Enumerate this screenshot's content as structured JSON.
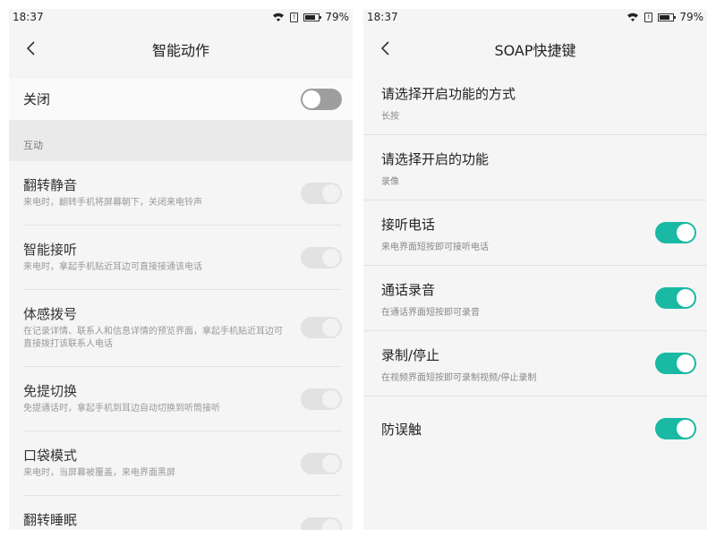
{
  "left": {
    "status": {
      "time": "18:37",
      "battery": "79%",
      "sim": "!"
    },
    "title": "智能动作",
    "master": {
      "label": "关闭",
      "on": false
    },
    "section": "互动",
    "items": [
      {
        "title": "翻转静音",
        "desc": "来电时，翻转手机将屏幕朝下，关闭来电铃声"
      },
      {
        "title": "智能接听",
        "desc": "来电时，拿起手机贴近耳边可直接接通该电话"
      },
      {
        "title": "体感拨号",
        "desc": "在记录详情、联系人和信息详情的预览界面，拿起手机贴近耳边可直接拨打该联系人电话"
      },
      {
        "title": "免提切换",
        "desc": "免提通话时，拿起手机到耳边自动切换到听筒接听"
      },
      {
        "title": "口袋模式",
        "desc": "来电时，当屏幕被覆盖，来电界面黑屏"
      },
      {
        "title": "翻转睡眠",
        "desc": ""
      }
    ]
  },
  "right": {
    "status": {
      "time": "18:37",
      "battery": "79%",
      "sim": "!"
    },
    "title": "SOAP快捷键",
    "items": [
      {
        "title": "请选择开启功能的方式",
        "desc": "长按"
      },
      {
        "title": "请选择开启的功能",
        "desc": "录像"
      },
      {
        "title": "接听电话",
        "desc": "来电界面短按即可接听电话",
        "on": true
      },
      {
        "title": "通话录音",
        "desc": "在通话界面短按即可录音",
        "on": true
      },
      {
        "title": "录制/停止",
        "desc": "在视频界面短按即可录制视频/停止录制",
        "on": true
      },
      {
        "title": "防误触",
        "desc": "",
        "on": true
      }
    ]
  },
  "battery_level": 0.79,
  "colors": {
    "accent": "#19b9a3",
    "toggle_off": "#9e9e9e",
    "toggle_disabled": "#e2e2e2"
  }
}
